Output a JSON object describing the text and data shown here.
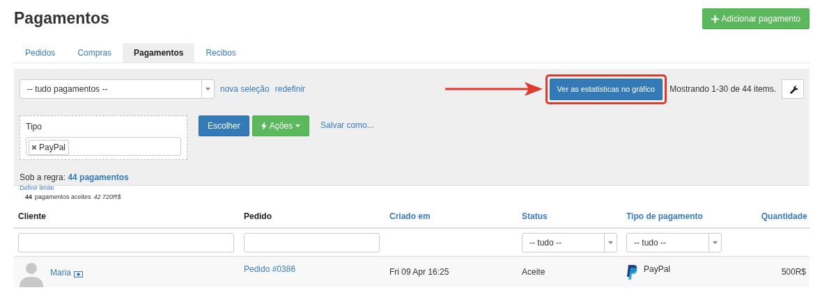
{
  "page_title": "Pagamentos",
  "add_button": "Adicionar pagamento",
  "tabs": [
    {
      "label": "Pedidos",
      "selected": false
    },
    {
      "label": "Compras",
      "selected": false
    },
    {
      "label": "Pagamentos",
      "selected": true
    },
    {
      "label": "Recibos",
      "selected": false
    }
  ],
  "filter_panel": {
    "preset_select": "-- tudo pagamentos --",
    "links": [
      "nova seleção",
      "redefinir"
    ],
    "stats_button": "Ver as estatísticas no gráfico",
    "highlighted": true,
    "showing": "Mostrando 1-30 de 44 items.",
    "rule": {
      "label": "Tipo",
      "tags": [
        "PayPal"
      ]
    },
    "choose_button": "Escolher",
    "actions_button": "Ações",
    "save_link": "Salvar como...",
    "rule_summary": "Sob a regra: **44 pagamentos**",
    "limit_link": "Definir limite"
  },
  "summary": {
    "count": "44",
    "label": "pagamentos aceites",
    "total": "42 720R$"
  },
  "table": {
    "columns": [
      {
        "label": "Cliente",
        "sortable": false,
        "kind": "input"
      },
      {
        "label": "Pedido",
        "sortable": false,
        "kind": "input"
      },
      {
        "label": "Criado em",
        "sortable": true,
        "kind": "plain"
      },
      {
        "label": "Status",
        "sortable": true,
        "kind": "select",
        "filter_value": "-- tudo --"
      },
      {
        "label": "Tipo de pagamento",
        "sortable": true,
        "kind": "select",
        "filter_value": "-- tudo --"
      },
      {
        "label": "Quantidade",
        "sortable": true,
        "kind": "plain"
      }
    ],
    "rows": [
      {
        "client": "Maria",
        "order": "Pedido #0386",
        "created": "Fri 09 Apr 16:25",
        "status": "Aceite",
        "payment_type": "PayPal",
        "amount": "500R$"
      }
    ]
  }
}
